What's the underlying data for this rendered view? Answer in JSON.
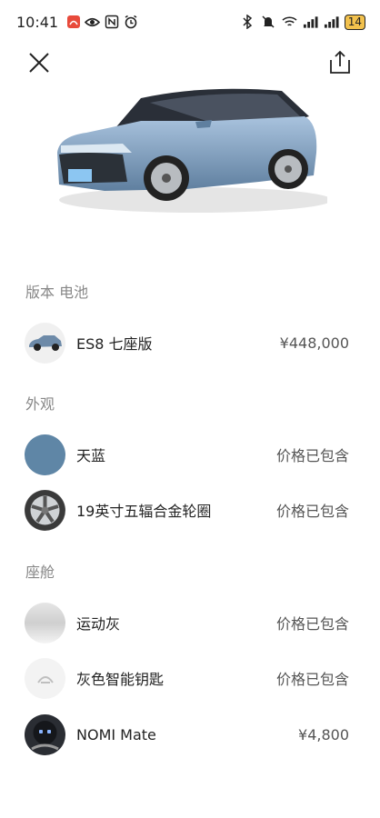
{
  "status_bar": {
    "time": "10:41",
    "battery": "14"
  },
  "sections": {
    "version": "版本 电池",
    "exterior": "外观",
    "cabin": "座舱"
  },
  "items": [
    {
      "label": "ES8 七座版",
      "price": "¥448,000"
    },
    {
      "label": "天蓝",
      "price": "价格已包含"
    },
    {
      "label": "19英寸五辐合金轮圈",
      "price": "价格已包含"
    },
    {
      "label": "运动灰",
      "price": "价格已包含"
    },
    {
      "label": "灰色智能钥匙",
      "price": "价格已包含"
    },
    {
      "label": "NOMI Mate",
      "price": "¥4,800"
    }
  ],
  "icons": {
    "close": "close-icon",
    "share": "share-icon"
  },
  "colors": {
    "sky_blue": "#5f86a6",
    "section_text": "#888888"
  }
}
